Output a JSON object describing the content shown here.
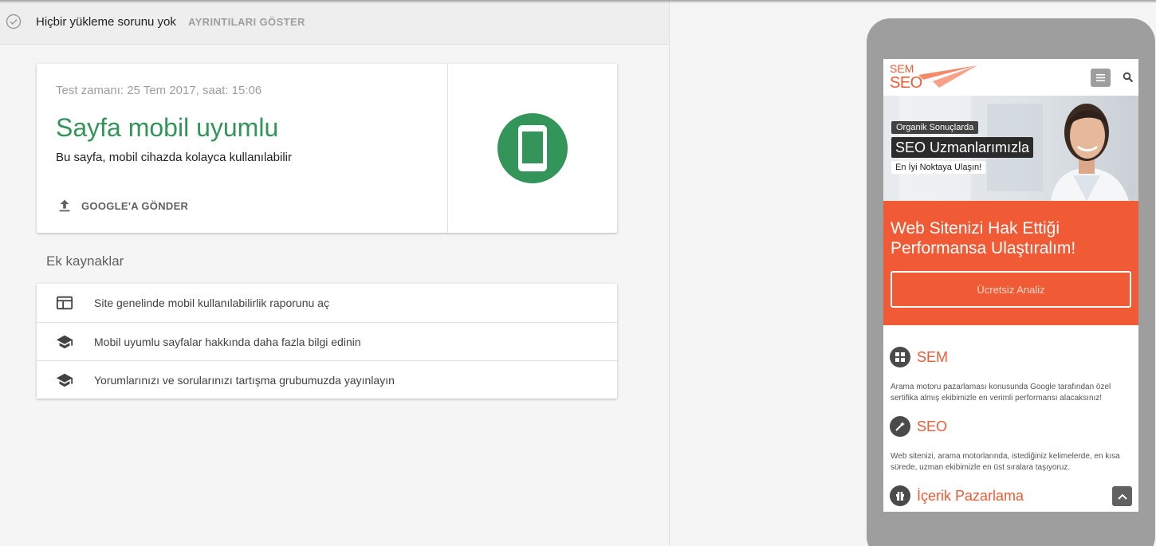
{
  "status": {
    "message": "Hiçbir yükleme sorunu yok",
    "details_label": "AYRINTILARI GÖSTER"
  },
  "result": {
    "test_time": "Test zamanı: 25 Tem 2017, saat: 15:06",
    "title": "Sayfa mobil uyumlu",
    "subtitle": "Bu sayfa, mobil cihazda kolayca kullanılabilir",
    "submit_label": "GOOGLE'A GÖNDER"
  },
  "resources": {
    "title": "Ek kaynaklar",
    "items": [
      {
        "label": "Site genelinde mobil kullanılabilirlik raporunu aç",
        "icon": "web-icon"
      },
      {
        "label": "Mobil uyumlu sayfalar hakkında daha fazla bilgi edinin",
        "icon": "school-icon"
      },
      {
        "label": "Yorumlarınızı ve sorularınızı tartışma grubumuzda yayınlayın",
        "icon": "school-icon"
      }
    ]
  },
  "preview": {
    "logo_top": "SEM",
    "logo_bottom": "SEO",
    "hero": {
      "tag1": "Organik Sonuçlarda",
      "tag2": "SEO Uzmanlarımızla",
      "tag3": "En İyi Noktaya Ulaşın!"
    },
    "promo": {
      "title": "Web Sitenizi Hak Ettiği Performansa Ulaştıralım!",
      "button": "Ücretsiz Analiz"
    },
    "services": [
      {
        "title": "SEM",
        "desc": "Arama motoru pazarlaması konusunda Google tarafından özel sertifika almış ekibimizle en verimli performansı alacaksınız!"
      },
      {
        "title": "SEO",
        "desc": "Web sitenizi, arama motorlarında, istediğiniz kelimelerde, en kısa sürede, uzman ekibimizle en üst sıralara taşıyoruz."
      },
      {
        "title": "İçerik Pazarlama",
        "desc": ""
      }
    ]
  },
  "colors": {
    "success_green": "#34955a",
    "brand_orange": "#f05a35",
    "phone_frame": "#9e9e9e"
  }
}
